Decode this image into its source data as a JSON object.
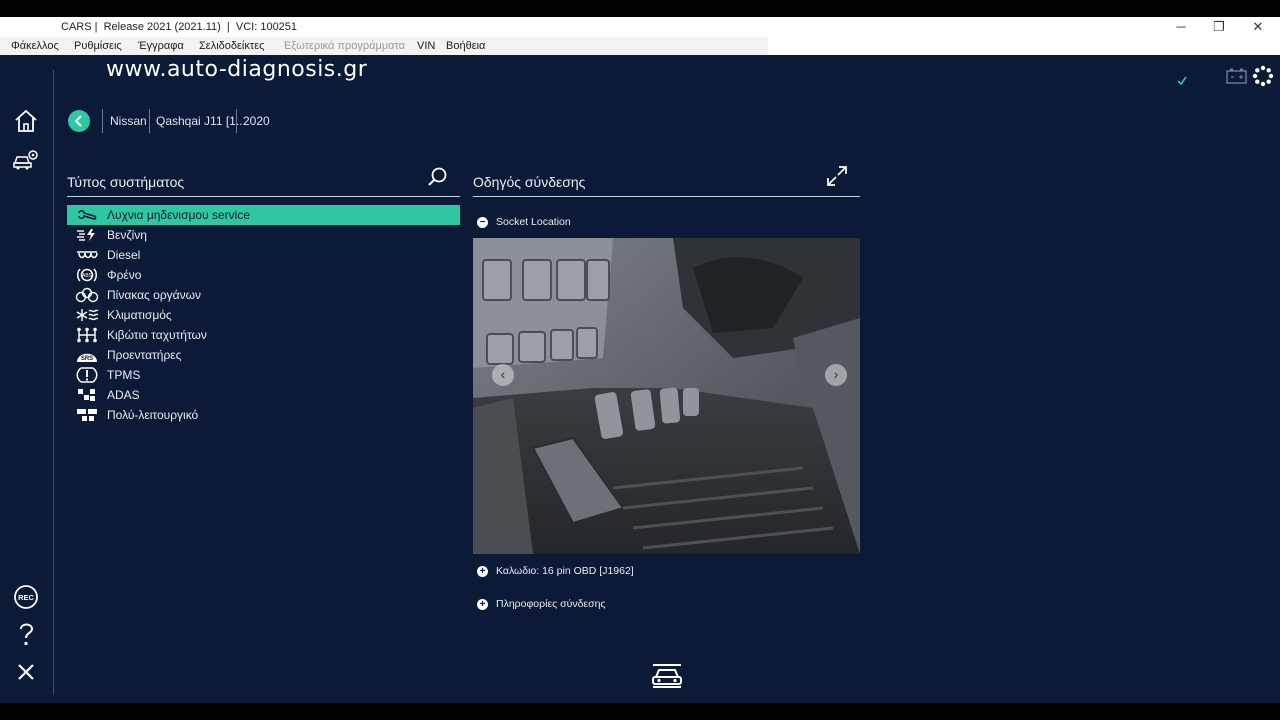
{
  "window": {
    "title": "CARS |  Release 2021 (2021.11)  |  VCI: 100251",
    "minimize": "─",
    "maximize": "❐",
    "close": "✕"
  },
  "menu": {
    "items": [
      "Φάκελλος",
      "Ρυθμίσεις",
      "Έγγραφα",
      "Σελιδοδείκτες",
      "Εξωτερικά προγράμματα",
      "VIN",
      "Βοήθεια"
    ]
  },
  "watermark": "www.auto-diagnosis.gr",
  "status": {
    "check_icon": "check-icon",
    "battery_icon": "battery-icon",
    "loading_icon": "loading-spinner-icon",
    "check_color": "#2fc6a0"
  },
  "breadcrumb": {
    "items": [
      "Nissan",
      "Qashqai J11 [1...",
      "2020"
    ]
  },
  "system_panel": {
    "title": "Τύπος συστήματος",
    "items": [
      {
        "label": "Λυχνια μηδενισμου service",
        "icon": "wrench-icon",
        "selected": true
      },
      {
        "label": "Βενζίνη",
        "icon": "petrol-injection-icon",
        "selected": false
      },
      {
        "label": "Diesel",
        "icon": "glow-plug-icon",
        "selected": false
      },
      {
        "label": "Φρένο",
        "icon": "abs-brake-icon",
        "selected": false
      },
      {
        "label": "Πίνακας οργάνων",
        "icon": "instrument-panel-icon",
        "selected": false
      },
      {
        "label": "Κλιματισμός",
        "icon": "air-conditioning-icon",
        "selected": false
      },
      {
        "label": "Κιβώτιο ταχυτήτων",
        "icon": "gearbox-icon",
        "selected": false
      },
      {
        "label": "Προεντατήρες",
        "icon": "srs-airbag-icon",
        "selected": false
      },
      {
        "label": "TPMS",
        "icon": "tpms-icon",
        "selected": false
      },
      {
        "label": "ADAS",
        "icon": "adas-icon",
        "selected": false
      },
      {
        "label": "Πολύ-λειτουργικό",
        "icon": "multifunction-icon",
        "selected": false
      }
    ]
  },
  "connection_panel": {
    "title": "Οδηγός σύνδεσης",
    "socket_location": "Socket Location",
    "cable": "Καλωδιο: 16 pin OBD [J1962]",
    "connection_info": "Πληροφορίες σύνδεσης"
  },
  "colors": {
    "background": "#0b1a36",
    "accent": "#2fc6a0",
    "text": "#e8edf5"
  }
}
